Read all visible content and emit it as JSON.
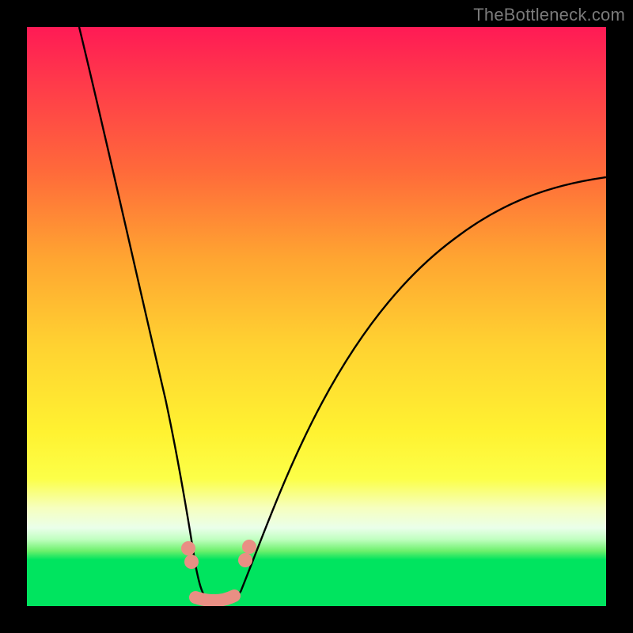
{
  "watermark": "TheBottleneck.com",
  "chart_data": {
    "type": "line",
    "title": "",
    "xlabel": "",
    "ylabel": "",
    "xlim": [
      0,
      100
    ],
    "ylim": [
      0,
      100
    ],
    "series": [
      {
        "name": "left-branch",
        "x": [
          9,
          12,
          15,
          18,
          20,
          22,
          24,
          25.5,
          27,
          28
        ],
        "y": [
          100,
          85,
          68,
          50,
          38,
          27,
          17,
          10,
          5,
          2
        ]
      },
      {
        "name": "right-branch",
        "x": [
          34,
          36,
          38,
          41,
          45,
          50,
          56,
          63,
          72,
          82,
          92,
          100
        ],
        "y": [
          2,
          6,
          11,
          18,
          27,
          36,
          45,
          53,
          61,
          67,
          71,
          74
        ]
      },
      {
        "name": "valley-floor",
        "x": [
          28,
          30,
          32,
          34
        ],
        "y": [
          2,
          1,
          1,
          2
        ]
      }
    ],
    "markers": [
      {
        "name": "left-pair-upper",
        "x": 26.3,
        "y": 9.2
      },
      {
        "name": "left-pair-lower",
        "x": 27.0,
        "y": 6.6
      },
      {
        "name": "right-pair-upper",
        "x": 36.3,
        "y": 9.4
      },
      {
        "name": "right-pair-lower",
        "x": 35.6,
        "y": 7.0
      },
      {
        "name": "floor-seg-start",
        "x": 28.2,
        "y": 1.6
      },
      {
        "name": "floor-seg-end",
        "x": 33.8,
        "y": 1.6
      }
    ],
    "grid": false,
    "legend": false
  }
}
